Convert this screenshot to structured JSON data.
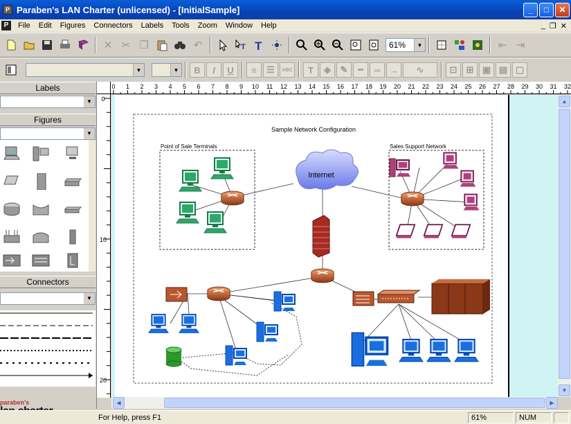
{
  "window": {
    "title": "Paraben's LAN Charter (unlicensed) - [InitialSample]",
    "app_icon_letter": "P",
    "minimize_glyph": "_",
    "maximize_glyph": "□",
    "close_glyph": "✕"
  },
  "menu": {
    "items": [
      "File",
      "Edit",
      "Figures",
      "Connectors",
      "Labels",
      "Tools",
      "Zoom",
      "Window",
      "Help"
    ],
    "mdi_minimize": "_",
    "mdi_restore": "❐",
    "mdi_close": "✕"
  },
  "toolbar": {
    "zoom_value": "61%"
  },
  "left_panel": {
    "labels_header": "Labels",
    "figures_header": "Figures",
    "connectors_header": "Connectors",
    "brand_top": "paraben's",
    "brand_bottom": "lan charter"
  },
  "rulers": {
    "h_ticks": [
      "0",
      "1",
      "2",
      "3",
      "4",
      "5",
      "6",
      "7",
      "8",
      "9",
      "10",
      "11",
      "12",
      "13",
      "14",
      "15",
      "16",
      "17",
      "18",
      "19",
      "20",
      "21",
      "22",
      "23",
      "24",
      "25",
      "26",
      "27",
      "28",
      "29",
      "30",
      "31",
      "32"
    ],
    "v_labels": [
      "0",
      "10",
      "20"
    ]
  },
  "diagram": {
    "title": "Sample Network Configuration",
    "group_left": "Point of Sale Terminals",
    "group_right": "Sales Support Network",
    "cloud_label": "Internet"
  },
  "status": {
    "help_text": "For Help, press F1",
    "zoom": "61%",
    "num": "NUM"
  },
  "colors": {
    "titlebar": "#0842b8",
    "canvas_bg": "#d0f4f4",
    "router": "#b8572e",
    "green_pc": "#2ea86a",
    "purple_pc": "#b0407a",
    "blue_pc": "#1a6ee0",
    "firewall": "#a82a20"
  }
}
